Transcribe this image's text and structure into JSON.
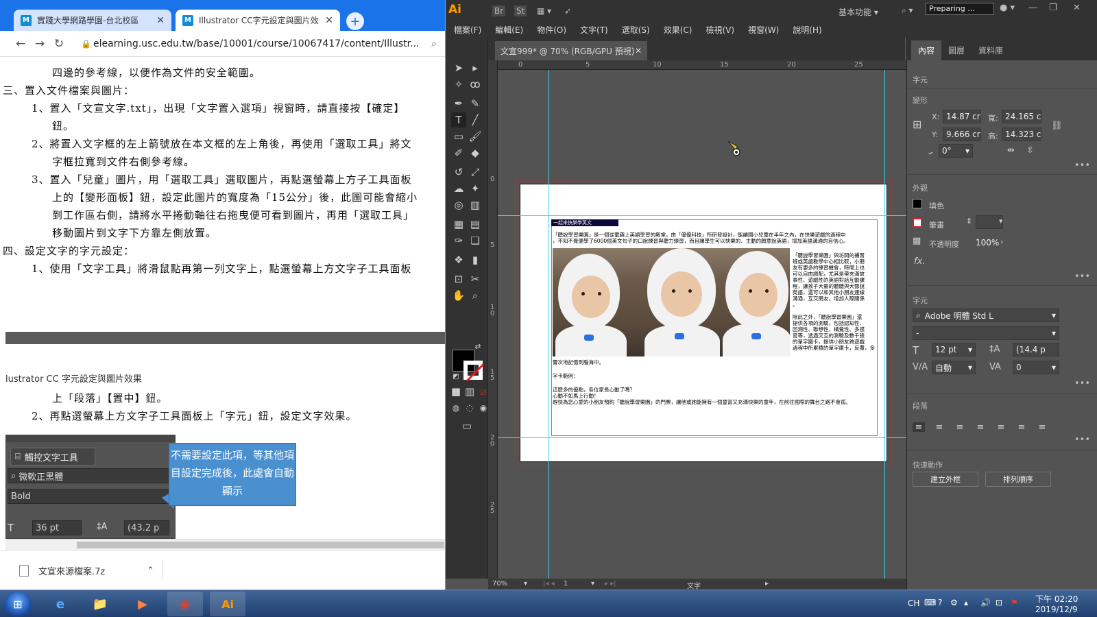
{
  "chrome": {
    "tabs": [
      {
        "label": "實踐大學網路學園-台北校區",
        "favicon": "M"
      },
      {
        "label": "Illustrator CC字元設定與圖片效",
        "favicon": "M"
      }
    ],
    "new_tab": "+",
    "url": "elearning.usc.edu.tw/base/10001/course/10067417/content/Illustr...",
    "nav_icons": [
      "back-icon",
      "forward-icon",
      "reload-icon"
    ]
  },
  "document": {
    "lines": [
      "四邊的參考線，以便作為文件的安全範圍。",
      "三、置入文件檔案與圖片：",
      "1、置入「文宣文字.txt」，出現「文字置入選項」視窗時，請直接按【確定】",
      "鈕。",
      "2、將置入文字框的左上箭號放在本文框的左上角後，再使用「選取工具」將文",
      "字框拉寬到文件右側參考線。",
      "3、置入「兒童」圖片，用「選取工具」選取圖片，再點選螢幕上方子工具面板",
      "上的【變形面板】鈕，設定此圖片的寬度為「15公分」後，此圖可能會縮小",
      "到工作區右側，請將水平捲動軸往右拖曳便可看到圖片，再用「選取工具」",
      "移動圖片到文字下方靠左側放置。",
      "四、設定文字的字元設定：",
      "1、使用「文字工具」將滑鼠點再第一列文字上，點選螢幕上方文字子工具面板"
    ],
    "caption": "lustrator CC 字元設定與圖片效果",
    "lines2": [
      "上「段落」【置中】鈕。",
      "2、再點選螢幕上方文字子工具面板上「字元」鈕，設定文字效果。"
    ],
    "mini_panel": {
      "button": "觸控文字工具",
      "font": "微軟正黑體",
      "style": "Bold",
      "size": "36 pt",
      "leading": "(43.2 p"
    },
    "callout": "不需要設定此項，等其他項目設定完成後，此處會自動顯示"
  },
  "download": {
    "file": "文宣來源檔案.7z"
  },
  "illustrator": {
    "logo": "Ai",
    "top_icons": [
      "Br",
      "St"
    ],
    "workspace": "基本功能",
    "status_box": "Preparing ...",
    "menu": [
      "檔案(F)",
      "編輯(E)",
      "物件(O)",
      "文字(T)",
      "選取(S)",
      "效果(C)",
      "檢視(V)",
      "視窗(W)",
      "說明(H)"
    ],
    "doc_tab": "文宣999* @ 70% (RGB/GPU 預視)",
    "ruler_h": [
      "0",
      "5",
      "10",
      "15",
      "20",
      "25"
    ],
    "ruler_v": [
      "0",
      "5",
      "1\n0",
      "1\n5",
      "2\n0",
      "2\n5"
    ],
    "art_text": {
      "headline": "一起來快樂學英文",
      "para1": "「聽說學習樂園」是一個從童趣上英語學習的殿堂，由「優優科技」所研發設計，能讓國小兒童在半年之內，在快樂遊戲的過程中",
      "para1b": "，不知不覺便學了6000個英文句子的口說練習與聽力練習，而且讓學生可以快樂的、主動的願意說英語，增加英語溝通的自信心。",
      "side": [
        "「聽說學習樂園」與坊間的補習",
        "班或英語教學中心相比較，小朋",
        "友有更多的練習機會，時間上也",
        "可以自由調配，尤其是帶充滿故",
        "事性、遊戲性的英語對話互動課",
        "程，讓孩子大量的聽聽與大聲說",
        "英語，還可以和其他小朋友連線",
        "溝通，互交朋友，增加人際關係",
        "。",
        "",
        "除此之外，「聽說學習樂園」還",
        "提供各項的測驗，包括認知性、",
        "回溯性、聯想性、構覺性、多感",
        "官等，透過交互的測驗及數千張",
        "的單字圖卡，提供小朋友跨遊戲",
        "過程中所累積的單字庫卡，反覆，多"
      ],
      "after1": "響次地記憶到腦海中。",
      "after2": "字卡範例：",
      "after3": "這麼多的優點，各位家長心動了嗎？",
      "after4": "心動不如馬上行動！",
      "after5": "趕快為您心愛的小朋友預約「聽說學習樂園」的門票，讓他或她能擁有一個豐富又充滿快樂的童年，在前往國際的舞台之路不會孤。"
    },
    "zoom": "70%",
    "page": "1",
    "status_tool": "文字"
  },
  "properties": {
    "tabs": [
      "內容",
      "圖層",
      "資料庫"
    ],
    "section_char_label": "字元",
    "transform_label": "變形",
    "x": "14.87 cn",
    "y": "9.666 cn",
    "w": "24.165 c",
    "h": "14.323 c",
    "angle": "0°",
    "appearance_label": "外觀",
    "fill_label": "填色",
    "stroke_label": "筆畫",
    "opacity_label": "不透明度",
    "opacity": "100%",
    "fx": "fx.",
    "char_label": "字元",
    "font": "Adobe 明體 Std L",
    "font_style": "-",
    "font_size": "12 pt",
    "leading": "(14.4 p",
    "kerning": "自動",
    "tracking": "0",
    "para_label": "段落",
    "quick_label": "快速動作",
    "quick_buttons": [
      "建立外框",
      "排列順序"
    ],
    "axis_x": "X:",
    "axis_y": "Y:",
    "axis_w": "寬:",
    "axis_h": "高:"
  },
  "taskbar": {
    "apps": [
      "e",
      "📁",
      "▶",
      "◉",
      "Ai"
    ],
    "lang": "CH",
    "time": "下午 02:20",
    "date": "2019/12/9"
  }
}
